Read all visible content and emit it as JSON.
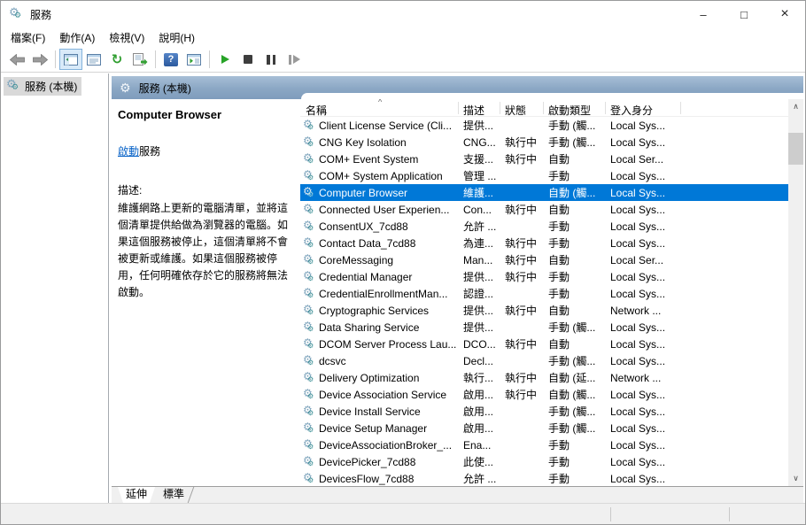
{
  "window": {
    "title": "服務",
    "minimize": "–",
    "maximize": "□",
    "close": "×"
  },
  "menu": {
    "items": [
      {
        "label": "檔案(F)"
      },
      {
        "label": "動作(A)"
      },
      {
        "label": "檢視(V)"
      },
      {
        "label": "說明(H)"
      }
    ]
  },
  "toolbar": {
    "help_glyph": "?",
    "refresh_glyph": "↻"
  },
  "tree": {
    "root": "服務 (本機)"
  },
  "panel": {
    "header": "服務 (本機)",
    "service_name": "Computer Browser",
    "action_link": "啟動",
    "action_suffix": "服務",
    "description_label": "描述:",
    "description": "維護網路上更新的電腦清單，並將這個清單提供給做為瀏覽器的電腦。如果這個服務被停止，這個清單將不會被更新或維護。如果這個服務被停用，任何明確依存於它的服務將無法啟動。"
  },
  "table": {
    "columns": [
      "名稱",
      "描述",
      "狀態",
      "啟動類型",
      "登入身分"
    ],
    "rows": [
      {
        "name": "Client License Service (Cli...",
        "desc": "提供...",
        "status": "",
        "startup": "手動 (觸...",
        "logon": "Local Sys...",
        "selected": false
      },
      {
        "name": "CNG Key Isolation",
        "desc": "CNG...",
        "status": "執行中",
        "startup": "手動 (觸...",
        "logon": "Local Sys...",
        "selected": false
      },
      {
        "name": "COM+ Event System",
        "desc": "支援...",
        "status": "執行中",
        "startup": "自動",
        "logon": "Local Ser...",
        "selected": false
      },
      {
        "name": "COM+ System Application",
        "desc": "管理 ...",
        "status": "",
        "startup": "手動",
        "logon": "Local Sys...",
        "selected": false
      },
      {
        "name": "Computer Browser",
        "desc": "維護...",
        "status": "",
        "startup": "自動 (觸...",
        "logon": "Local Sys...",
        "selected": true
      },
      {
        "name": "Connected User Experien...",
        "desc": "Con...",
        "status": "執行中",
        "startup": "自動",
        "logon": "Local Sys...",
        "selected": false
      },
      {
        "name": "ConsentUX_7cd88",
        "desc": "允許 ...",
        "status": "",
        "startup": "手動",
        "logon": "Local Sys...",
        "selected": false
      },
      {
        "name": "Contact Data_7cd88",
        "desc": "為連...",
        "status": "執行中",
        "startup": "手動",
        "logon": "Local Sys...",
        "selected": false
      },
      {
        "name": "CoreMessaging",
        "desc": "Man...",
        "status": "執行中",
        "startup": "自動",
        "logon": "Local Ser...",
        "selected": false
      },
      {
        "name": "Credential Manager",
        "desc": "提供...",
        "status": "執行中",
        "startup": "手動",
        "logon": "Local Sys...",
        "selected": false
      },
      {
        "name": "CredentialEnrollmentMan...",
        "desc": "認證...",
        "status": "",
        "startup": "手動",
        "logon": "Local Sys...",
        "selected": false
      },
      {
        "name": "Cryptographic Services",
        "desc": "提供...",
        "status": "執行中",
        "startup": "自動",
        "logon": "Network ...",
        "selected": false
      },
      {
        "name": "Data Sharing Service",
        "desc": "提供...",
        "status": "",
        "startup": "手動 (觸...",
        "logon": "Local Sys...",
        "selected": false
      },
      {
        "name": "DCOM Server Process Lau...",
        "desc": "DCO...",
        "status": "執行中",
        "startup": "自動",
        "logon": "Local Sys...",
        "selected": false
      },
      {
        "name": "dcsvc",
        "desc": "Decl...",
        "status": "",
        "startup": "手動 (觸...",
        "logon": "Local Sys...",
        "selected": false
      },
      {
        "name": "Delivery Optimization",
        "desc": "執行...",
        "status": "執行中",
        "startup": "自動 (延...",
        "logon": "Network ...",
        "selected": false
      },
      {
        "name": "Device Association Service",
        "desc": "啟用...",
        "status": "執行中",
        "startup": "自動 (觸...",
        "logon": "Local Sys...",
        "selected": false
      },
      {
        "name": "Device Install Service",
        "desc": "啟用...",
        "status": "",
        "startup": "手動 (觸...",
        "logon": "Local Sys...",
        "selected": false
      },
      {
        "name": "Device Setup Manager",
        "desc": "啟用...",
        "status": "",
        "startup": "手動 (觸...",
        "logon": "Local Sys...",
        "selected": false
      },
      {
        "name": "DeviceAssociationBroker_...",
        "desc": "Ena...",
        "status": "",
        "startup": "手動",
        "logon": "Local Sys...",
        "selected": false
      },
      {
        "name": "DevicePicker_7cd88",
        "desc": "此使...",
        "status": "",
        "startup": "手動",
        "logon": "Local Sys...",
        "selected": false
      },
      {
        "name": "DevicesFlow_7cd88",
        "desc": "允許 ...",
        "status": "",
        "startup": "手動",
        "logon": "Local Sys...",
        "selected": false
      }
    ]
  },
  "tabs": {
    "extended": "延伸",
    "standard": "標準"
  },
  "icons": {
    "gear": "⚙",
    "sort_asc": "^",
    "scroll_up": "∧",
    "scroll_down": "∨"
  },
  "colors": {
    "selection": "#0078d7",
    "header_bar_top": "#a7bed6",
    "header_bar_bottom": "#7e9cbc",
    "inactive_selection": "#d9d9d9"
  }
}
